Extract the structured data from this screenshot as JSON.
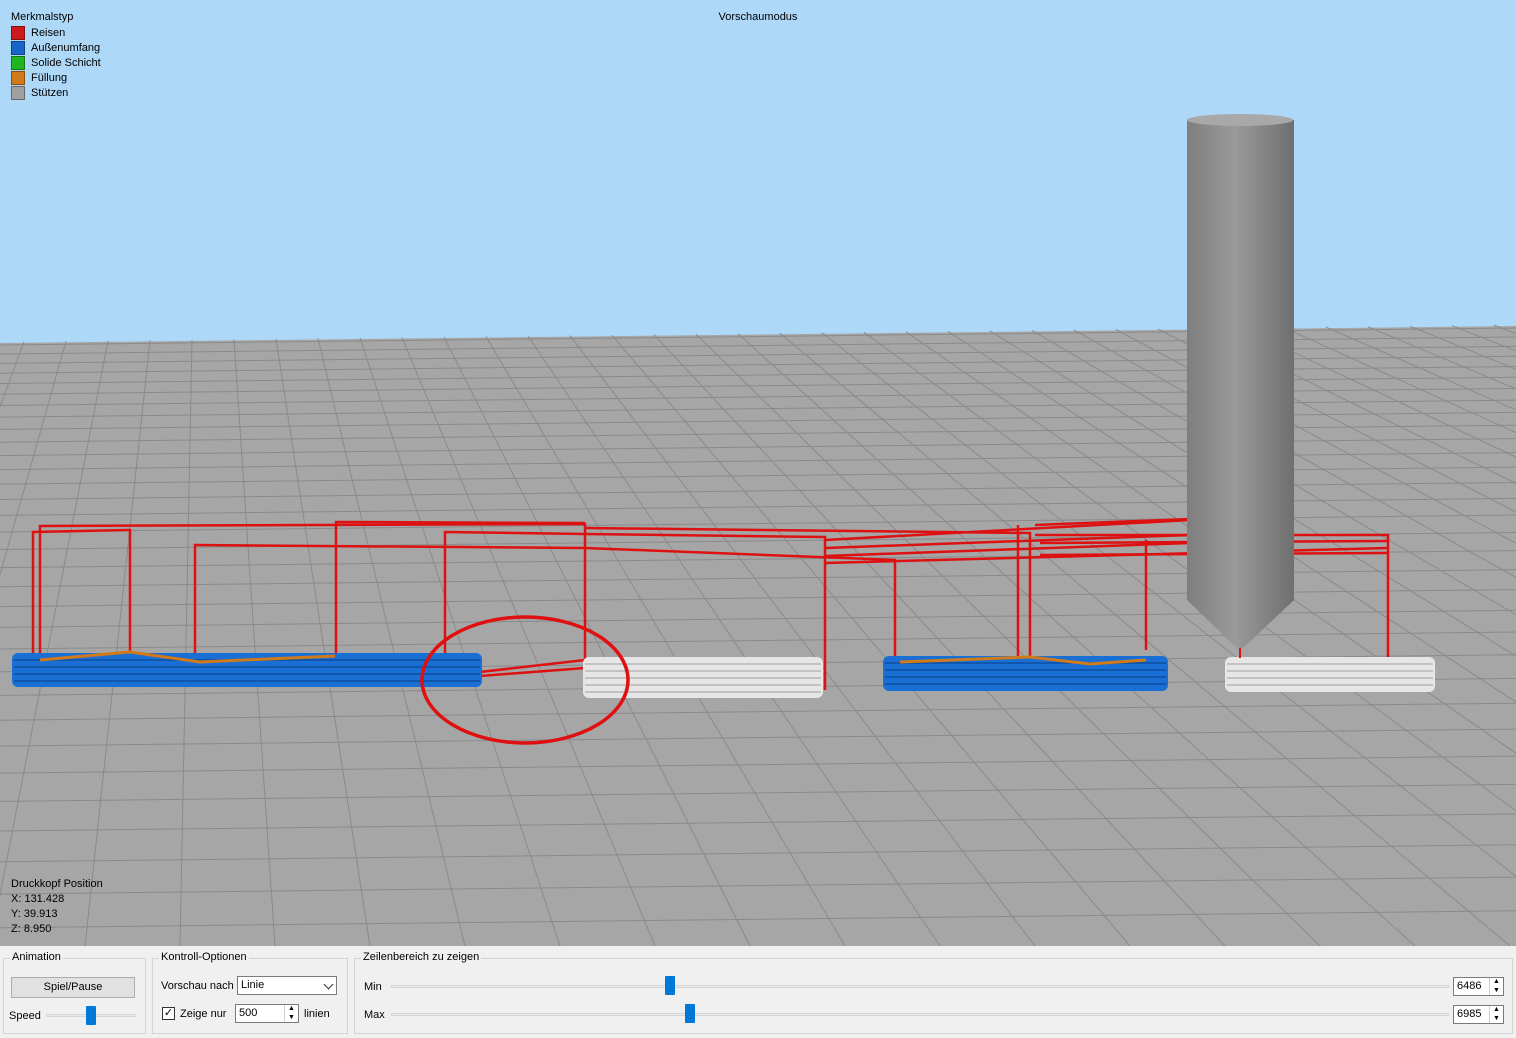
{
  "viewport": {
    "mode_label": "Vorschaumodus",
    "legend": {
      "title": "Merkmalstyp",
      "items": [
        {
          "label": "Reisen",
          "color": "#cc1a1a"
        },
        {
          "label": "Außenumfang",
          "color": "#1a64c8"
        },
        {
          "label": "Solide Schicht",
          "color": "#22b522"
        },
        {
          "label": "Füllung",
          "color": "#d17a1a"
        },
        {
          "label": "Stützen",
          "color": "#a0a0a0"
        }
      ]
    },
    "head_position": {
      "title": "Druckkopf Position",
      "x": "X: 131.428",
      "y": "Y: 39.913",
      "z": "Z: 8.950"
    },
    "colors": {
      "sky": "#aed8f8",
      "bed": "#a6a6a6",
      "grid": "#8a8a8a",
      "travel": "#dd1111",
      "perimeter": "#1a6fd4",
      "infill": "#d17a1a",
      "support": "#e6e6e6",
      "nozzle": "#8c8c8c"
    }
  },
  "controls": {
    "animation": {
      "title": "Animation",
      "play_pause_label": "Spiel/Pause",
      "speed_label": "Speed"
    },
    "control_options": {
      "title": "Kontroll-Optionen",
      "preview_by_label": "Vorschau nach",
      "preview_by_value": "Linie",
      "show_only_label": "Zeige nur",
      "show_only_checked": true,
      "show_only_value": "500",
      "lines_label": "linien"
    },
    "line_range": {
      "title": "Zeilenbereich zu zeigen",
      "min_label": "Min",
      "min_value": "6486",
      "max_label": "Max",
      "max_value": "6985"
    }
  }
}
